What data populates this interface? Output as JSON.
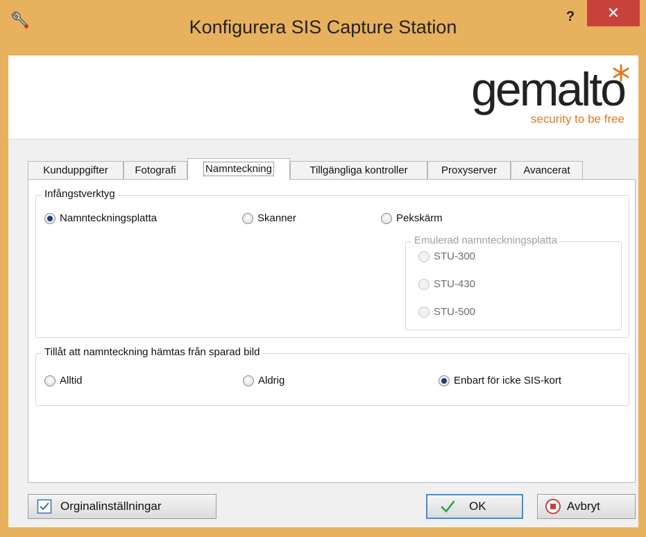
{
  "window": {
    "title": "Konfigurera SIS Capture Station",
    "help_label": "?",
    "close_label": "✕"
  },
  "banner": {
    "logo_text": "gemalto",
    "logo_tagline": "security to be free"
  },
  "tabs": [
    {
      "label": "Kunduppgifter",
      "active": false
    },
    {
      "label": "Fotografi",
      "active": false
    },
    {
      "label": "Namnteckning",
      "active": true
    },
    {
      "label": "Tillgängliga kontroller",
      "active": false
    },
    {
      "label": "Proxyserver",
      "active": false
    },
    {
      "label": "Avancerat",
      "active": false
    }
  ],
  "capture_group": {
    "legend": "Infångstverktyg",
    "options": [
      {
        "label": "Namnteckningsplatta",
        "selected": true
      },
      {
        "label": "Skanner",
        "selected": false
      },
      {
        "label": "Pekskärm",
        "selected": false
      }
    ],
    "emulated_group": {
      "legend": "Emulerad namnteckningsplatta",
      "options": [
        {
          "label": "STU-300",
          "selected": false
        },
        {
          "label": "STU-430",
          "selected": false
        },
        {
          "label": "STU-500",
          "selected": false
        }
      ]
    }
  },
  "saved_image_group": {
    "legend": "Tillåt att namnteckning hämtas från sparad bild",
    "options": [
      {
        "label": "Alltid",
        "selected": false
      },
      {
        "label": "Aldrig",
        "selected": false
      },
      {
        "label": "Enbart för icke SIS-kort",
        "selected": true
      }
    ]
  },
  "buttons": {
    "defaults_label": "Orginalinställningar",
    "ok_label": "OK",
    "cancel_label": "Avbryt"
  },
  "colors": {
    "frame": "#e8b15e",
    "close_button": "#c8423c",
    "logo_accent": "#e37a1f",
    "default_button_border": "#3d8fd9"
  }
}
